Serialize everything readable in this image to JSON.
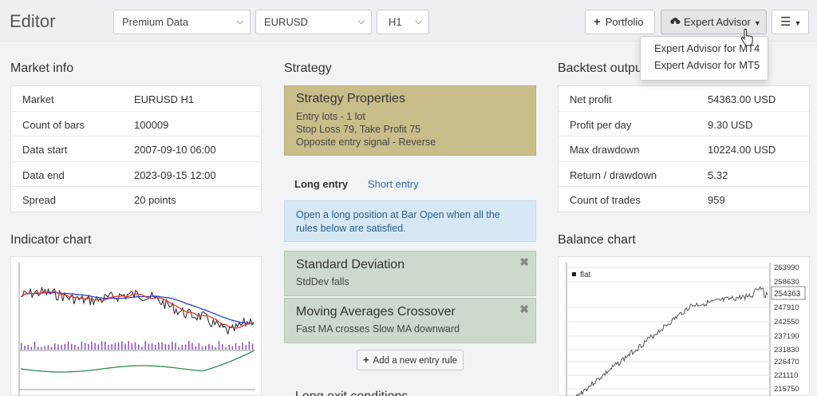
{
  "header": {
    "title": "Editor",
    "data_source": "Premium Data",
    "symbol": "EURUSD",
    "period": "H1",
    "portfolio_label": "Portfolio",
    "expert_advisor_label": "Expert Advisor",
    "menu_items": [
      "Expert Advisor for MT4",
      "Expert Advisor for MT5"
    ]
  },
  "market_info": {
    "title": "Market info",
    "rows": [
      {
        "key": "Market",
        "value": "EURUSD H1"
      },
      {
        "key": "Count of bars",
        "value": "100009"
      },
      {
        "key": "Data start",
        "value": "2007-09-10 06:00"
      },
      {
        "key": "Data end",
        "value": "2023-09-15 12:00"
      },
      {
        "key": "Spread",
        "value": "20 points"
      }
    ]
  },
  "strategy": {
    "title": "Strategy",
    "properties": {
      "title": "Strategy Properties",
      "lines": [
        "Entry lots - 1 lot",
        "Stop Loss 79, Take Profit 75",
        "Opposite entry signal - Reverse"
      ]
    },
    "tabs": {
      "long": "Long entry",
      "short": "Short entry"
    },
    "info": "Open a long position at Bar Open when all the rules below are satisfied.",
    "rules": [
      {
        "title": "Standard Deviation",
        "desc": "StdDev falls"
      },
      {
        "title": "Moving Averages Crossover",
        "desc": "Fast MA crosses Slow MA downward"
      }
    ],
    "add_rule_label": "Add a new entry rule",
    "next_section_partial": "Long exit conditions"
  },
  "backtest": {
    "title": "Backtest output",
    "rows": [
      {
        "key": "Net profit",
        "value": "54363.00 USD"
      },
      {
        "key": "Profit per day",
        "value": "9.30 USD"
      },
      {
        "key": "Max drawdown",
        "value": "10224.00 USD"
      },
      {
        "key": "Return / drawdown",
        "value": "5.32"
      },
      {
        "key": "Count of trades",
        "value": "959"
      }
    ]
  },
  "indicator_chart": {
    "title": "Indicator chart",
    "colors": {
      "price": "#222222",
      "fast_ma": "#e03a2a",
      "slow_ma": "#2c3fd1",
      "volume": "#8a4fc0",
      "oscillator": "#2e8b57"
    }
  },
  "balance_chart": {
    "title": "Balance chart",
    "legend": "flat",
    "current_value": "254363",
    "y_ticks": [
      "263990",
      "258630",
      "254363",
      "247910",
      "242550",
      "237190",
      "231830",
      "226470",
      "221110",
      "215750"
    ],
    "color": "#555555"
  }
}
